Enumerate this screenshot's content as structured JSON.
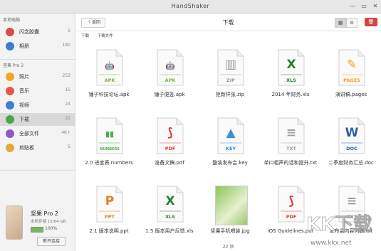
{
  "window": {
    "title": "HandShaker"
  },
  "sidebar": {
    "local_section": "本地电脑",
    "local_items": [
      {
        "label": "闪念胶囊",
        "count": "5",
        "color": "#d94a4a",
        "icon": "capsule-icon"
      },
      {
        "label": "相册",
        "count": "180",
        "color": "#3b7fd0",
        "icon": "photos-icon"
      }
    ],
    "device_section": "坚果 Pro 2",
    "device_items": [
      {
        "label": "照片",
        "count": "253",
        "color": "#f2a81d",
        "icon": "photo-icon"
      },
      {
        "label": "音乐",
        "count": "15",
        "color": "#e2574c",
        "icon": "music-icon"
      },
      {
        "label": "视频",
        "count": "24",
        "color": "#3d7fd6",
        "icon": "video-icon"
      },
      {
        "label": "下载",
        "count": "22",
        "color": "#4aa846",
        "icon": "download-icon"
      },
      {
        "label": "全部文件",
        "count": "4K+",
        "color": "#8e58c7",
        "icon": "all-files-icon"
      },
      {
        "label": "剪贴板",
        "count": "5",
        "color": "#e1a83a",
        "icon": "clipboard-icon"
      }
    ],
    "device": {
      "name": "坚果 Pro 2",
      "storage": "本机存储 15/64 GB",
      "battery": "100%",
      "battery_level": 1.0,
      "disconnect_label": "断开连接"
    }
  },
  "toolbar": {
    "back_label": "〈 返回",
    "title": "下载",
    "grid_view": "▦",
    "list_view": "≡",
    "delete_icon": "🗑"
  },
  "breadcrumb": [
    "下载",
    "下载文件"
  ],
  "files": [
    {
      "name": "锤子科技论坛.apk",
      "type": "APK",
      "color": "#7cb342",
      "glyph": "🤖"
    },
    {
      "name": "锤子便签.apk",
      "type": "APK",
      "color": "#7cb342",
      "glyph": "🤖"
    },
    {
      "name": "拒新样张.zip",
      "type": "ZIP",
      "color": "#9a9a9a",
      "glyph": "▥"
    },
    {
      "name": "2014 年财务.xls",
      "type": "XLS",
      "color": "#2e7d32",
      "glyph": "X"
    },
    {
      "name": "演讲稿.pages",
      "type": "PAGES",
      "color": "#f0a030",
      "glyph": "✎"
    },
    {
      "name": "2.0 进度表.numbers",
      "type": "NUMBERS",
      "color": "#4caf50",
      "glyph": "▮▮"
    },
    {
      "name": "准备文稿.pdf",
      "type": "PDF",
      "color": "#e53935",
      "glyph": "⟆"
    },
    {
      "name": "整装发布会.key",
      "type": "KEY",
      "color": "#3e8ede",
      "glyph": "▲"
    },
    {
      "name": "单口相声的话和提升.txt",
      "type": "TXT",
      "color": "#9e9e9e",
      "glyph": "≡"
    },
    {
      "name": "二季度财务汇总.doc",
      "type": "DOC",
      "color": "#2b5faa",
      "glyph": "W"
    },
    {
      "name": "2.1 版本说明.ppt",
      "type": "PPT",
      "color": "#e67e22",
      "glyph": "P"
    },
    {
      "name": "1.5 版本用户反馈.xls",
      "type": "XLS",
      "color": "#2e7d32",
      "glyph": "X"
    },
    {
      "name": "坚果手机喂装.jpg",
      "type": "JPG",
      "color": "#8bc34a",
      "glyph": ""
    },
    {
      "name": "iOS Guidelines.pdf",
      "type": "PDF",
      "color": "#e53935",
      "glyph": "⟆"
    },
    {
      "name": "发布会内容列表.txt",
      "type": "TXT",
      "color": "#9e9e9e",
      "glyph": "≡"
    }
  ],
  "footer": {
    "count": "22 项"
  },
  "watermark": {
    "text": "KK下载",
    "url": "www.kkx.net"
  }
}
